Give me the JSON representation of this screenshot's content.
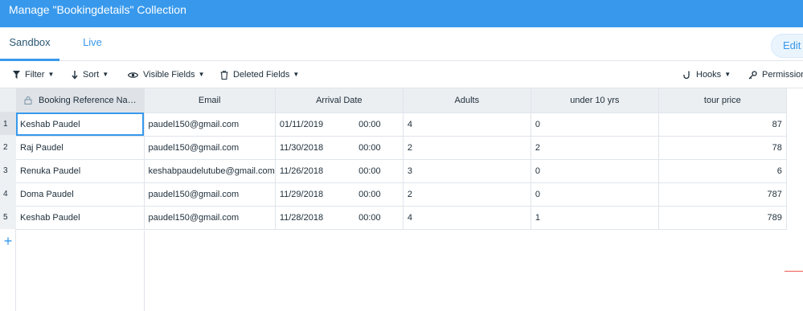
{
  "title": "Manage \"Bookingdetails\" Collection",
  "tabs": {
    "sandbox": "Sandbox",
    "live": "Live"
  },
  "edit_button": "Edit Live",
  "toolbar": {
    "filter": "Filter",
    "sort": "Sort",
    "visible_fields": "Visible Fields",
    "deleted_fields": "Deleted Fields",
    "hooks": "Hooks",
    "permissions": "Permissions"
  },
  "columns": [
    "Booking Reference Na…",
    "Email",
    "Arrival Date",
    "Adults",
    "under 10 yrs",
    "tour price"
  ],
  "rows": [
    {
      "num": "1",
      "name": "Keshab Paudel",
      "email": "paudel150@gmail.com",
      "date": "01/11/2019",
      "time": "00:00",
      "adults": "4",
      "under10": "0",
      "price": "87"
    },
    {
      "num": "2",
      "name": "Raj Paudel",
      "email": "paudel150@gmail.com",
      "date": "11/30/2018",
      "time": "00:00",
      "adults": "2",
      "under10": "2",
      "price": "78"
    },
    {
      "num": "3",
      "name": "Renuka Paudel",
      "email": "keshabpaudelutube@gmail.com",
      "date": "11/26/2018",
      "time": "00:00",
      "adults": "3",
      "under10": "0",
      "price": "6"
    },
    {
      "num": "4",
      "name": "Doma Paudel",
      "email": "paudel150@gmail.com",
      "date": "11/29/2018",
      "time": "00:00",
      "adults": "2",
      "under10": "0",
      "price": "787"
    },
    {
      "num": "5",
      "name": "Keshab Paudel",
      "email": "paudel150@gmail.com",
      "date": "11/28/2018",
      "time": "00:00",
      "adults": "4",
      "under10": "1",
      "price": "789"
    }
  ],
  "add_row_symbol": "+"
}
